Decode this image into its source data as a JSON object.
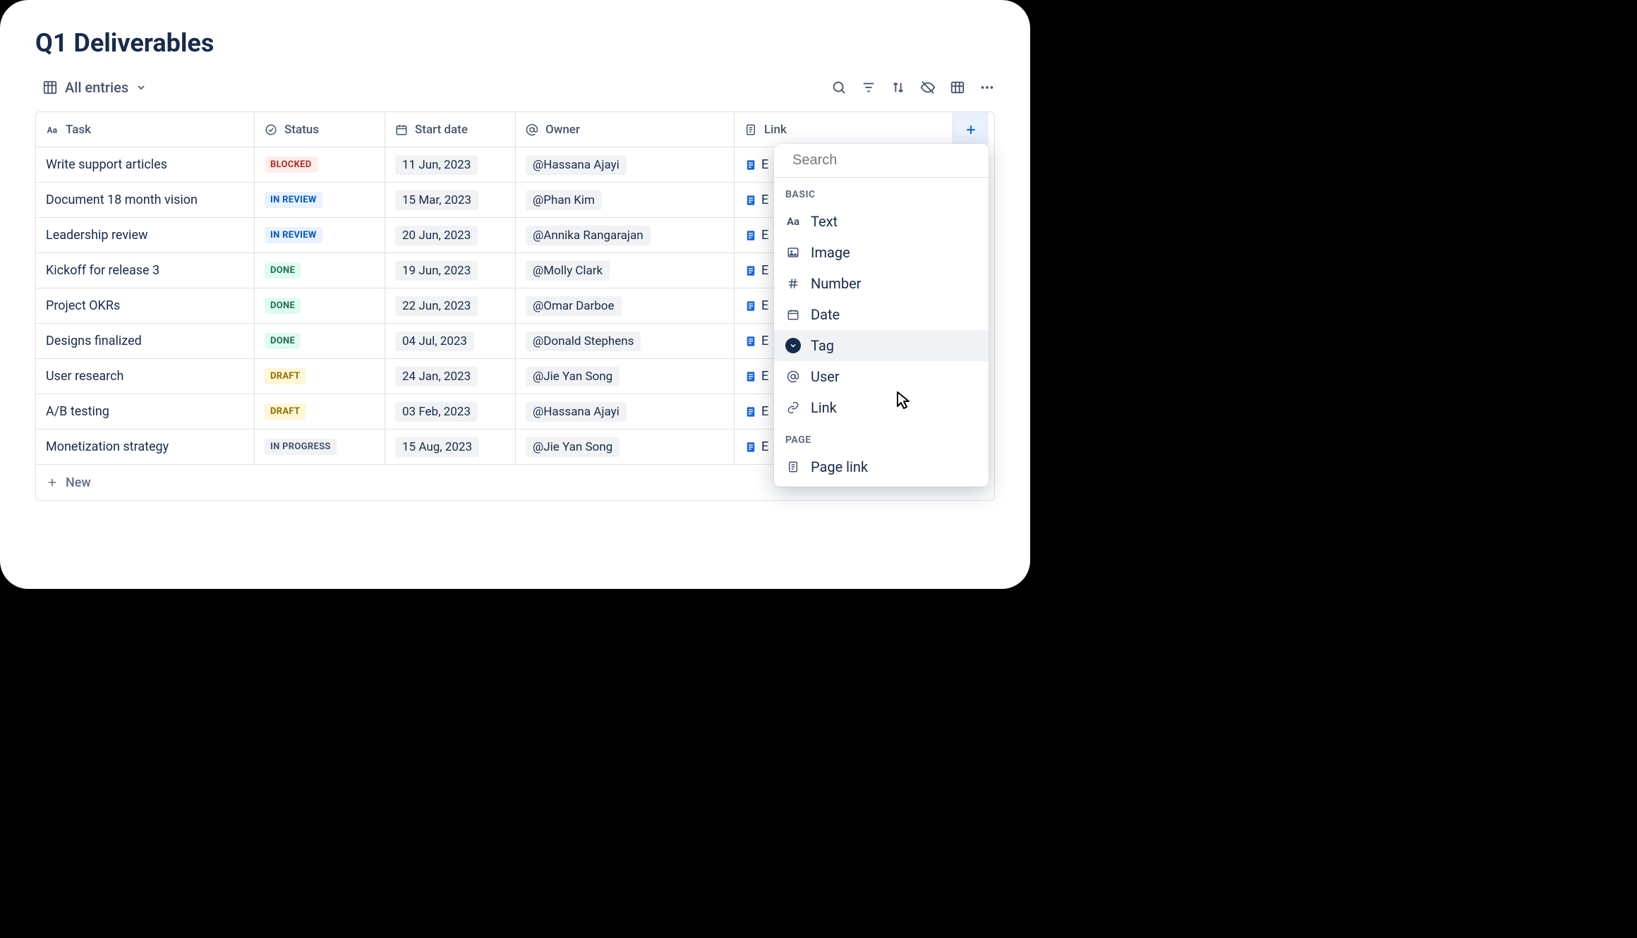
{
  "title": "Q1 Deliverables",
  "view": {
    "label": "All entries"
  },
  "search_placeholder": "Search",
  "columns": {
    "task": "Task",
    "status": "Status",
    "start_date": "Start date",
    "owner": "Owner",
    "link": "Link"
  },
  "rows": [
    {
      "task": "Write support articles",
      "status": "BLOCKED",
      "date": "11 Jun, 2023",
      "owner": "@Hassana Ajayi",
      "link": "E"
    },
    {
      "task": "Document 18 month vision",
      "status": "IN REVIEW",
      "date": "15 Mar, 2023",
      "owner": "@Phan Kim",
      "link": "E"
    },
    {
      "task": "Leadership review",
      "status": "IN REVIEW",
      "date": "20 Jun, 2023",
      "owner": "@Annika Rangarajan",
      "link": "E"
    },
    {
      "task": "Kickoff for release 3",
      "status": "DONE",
      "date": "19 Jun, 2023",
      "owner": "@Molly Clark",
      "link": "E"
    },
    {
      "task": "Project OKRs",
      "status": "DONE",
      "date": "22 Jun, 2023",
      "owner": "@Omar Darboe",
      "link": "E"
    },
    {
      "task": "Designs finalized",
      "status": "DONE",
      "date": "04 Jul, 2023",
      "owner": "@Donald Stephens",
      "link": "E"
    },
    {
      "task": "User research",
      "status": "DRAFT",
      "date": "24 Jan, 2023",
      "owner": "@Jie Yan Song",
      "link": "E"
    },
    {
      "task": "A/B testing",
      "status": "DRAFT",
      "date": "03 Feb, 2023",
      "owner": "@Hassana Ajayi",
      "link": "E"
    },
    {
      "task": "Monetization strategy",
      "status": "IN PROGRESS",
      "date": "15 Aug, 2023",
      "owner": "@Jie Yan Song",
      "link": "E"
    }
  ],
  "new_row_label": "New",
  "dropdown": {
    "group_basic": "BASIC",
    "group_page": "PAGE",
    "items": {
      "text": "Text",
      "image": "Image",
      "number": "Number",
      "date": "Date",
      "tag": "Tag",
      "user": "User",
      "link": "Link",
      "page_link": "Page link"
    }
  }
}
